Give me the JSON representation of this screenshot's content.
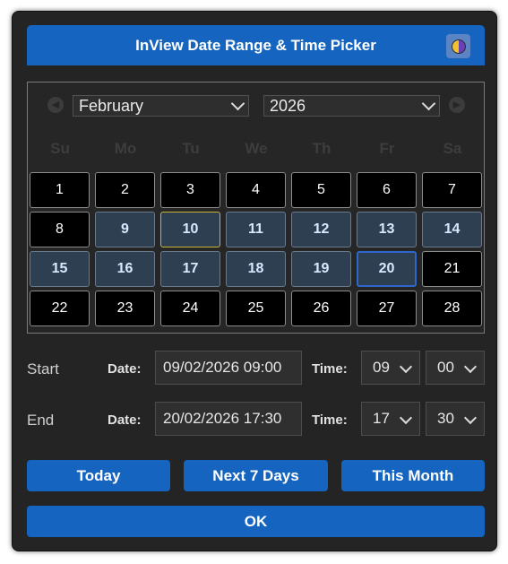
{
  "title": "InView Date Range & Time Picker",
  "theme_toggle_icon": "half-moon-icon",
  "calendar": {
    "prev_icon": "chevron-left-icon",
    "next_icon": "chevron-right-icon",
    "month": "February",
    "year": "2026",
    "weekdays": [
      "Su",
      "Mo",
      "Tu",
      "We",
      "Th",
      "Fr",
      "Sa"
    ],
    "days": [
      "1",
      "2",
      "3",
      "4",
      "5",
      "6",
      "7",
      "8",
      "9",
      "10",
      "11",
      "12",
      "13",
      "14",
      "15",
      "16",
      "17",
      "18",
      "19",
      "20",
      "21",
      "22",
      "23",
      "24",
      "25",
      "26",
      "27",
      "28"
    ],
    "range_start_day": 9,
    "range_end_day": 20,
    "today_day": 10
  },
  "start": {
    "label": "Start",
    "date_label": "Date:",
    "date_value": "09/02/2026 09:00",
    "time_label": "Time:",
    "hour": "09",
    "minute": "00"
  },
  "end": {
    "label": "End",
    "date_label": "Date:",
    "date_value": "20/02/2026 17:30",
    "time_label": "Time:",
    "hour": "17",
    "minute": "30"
  },
  "buttons": {
    "today": "Today",
    "next7": "Next 7 Days",
    "this_month": "This Month",
    "ok": "OK"
  },
  "colors": {
    "accent": "#1565c0",
    "dialog_bg": "#242424",
    "range_bg": "#2e3f52"
  }
}
